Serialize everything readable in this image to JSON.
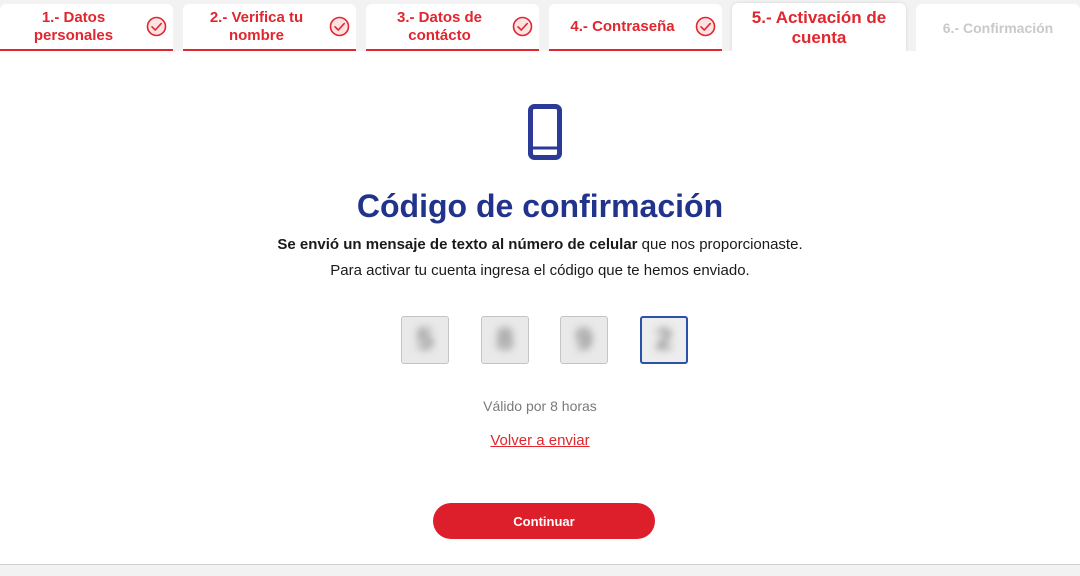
{
  "steps": [
    {
      "label": "1.- Datos personales",
      "completed": true
    },
    {
      "label": "2.- Verifica tu nombre",
      "completed": true
    },
    {
      "label": "3.- Datos de contácto",
      "completed": true
    },
    {
      "label": "4.- Contraseña",
      "completed": true
    },
    {
      "label": "5.- Activación de cuenta",
      "active": true
    },
    {
      "label": "6.- Confirmación",
      "active": false
    }
  ],
  "main": {
    "icon": "smartphone-icon",
    "title": "Código de confirmación",
    "desc_bold": "Se envió un mensaje de texto al número de celular",
    "desc_rest": " que nos proporcionaste.",
    "desc_line2": "Para activar tu cuenta ingresa el código que te hemos enviado.",
    "code_digits": [
      "5",
      "8",
      "9",
      "2"
    ],
    "validity": "Válido por 8 horas",
    "resend_label": "Volver a enviar",
    "continue_label": "Continuar"
  },
  "colors": {
    "accent": "#e0262e",
    "title": "#22338c",
    "focus": "#2a52a8"
  }
}
